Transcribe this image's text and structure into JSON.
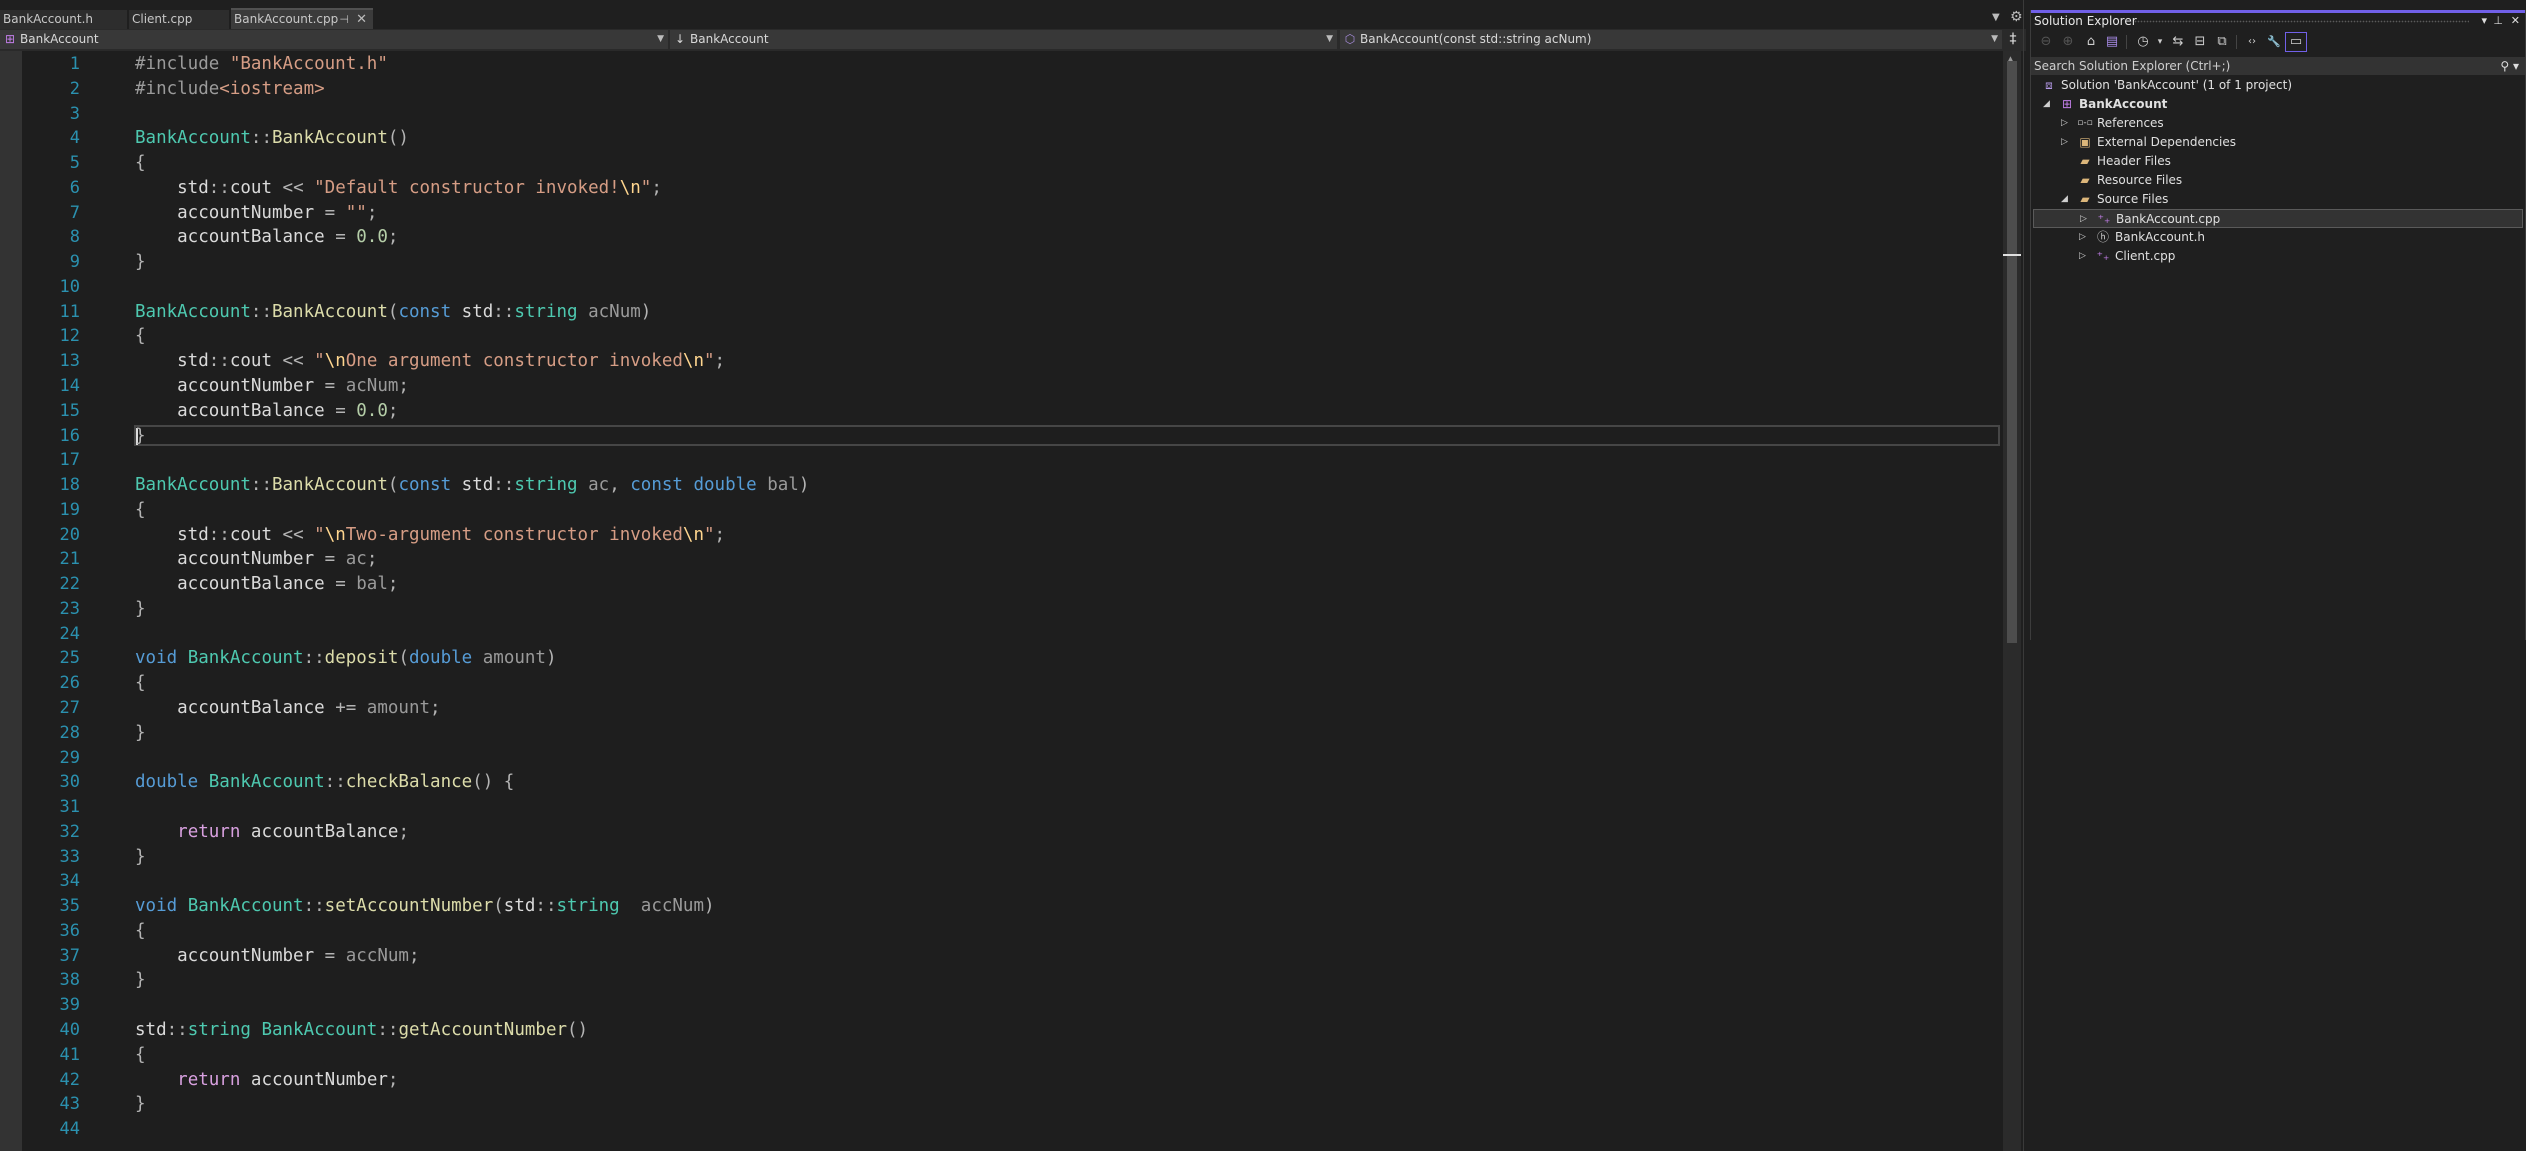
{
  "tabs": [
    {
      "label": "BankAccount.h",
      "active": false
    },
    {
      "label": "Client.cpp",
      "active": false
    },
    {
      "label": "BankAccount.cpp",
      "active": true
    }
  ],
  "tab_icons": {
    "pin": "⊣",
    "close": "✕",
    "overflow": "▼",
    "settings": "⚙"
  },
  "navbar": {
    "project": "BankAccount",
    "scope": "BankAccount",
    "member": "BankAccount(const std::string acNum)"
  },
  "editor": {
    "current_line": 16,
    "line_count": 44,
    "lines": [
      [
        [
          "pp",
          "#include "
        ],
        [
          "st",
          "\"BankAccount.h\""
        ]
      ],
      [
        [
          "pp",
          "#include"
        ],
        [
          "st",
          "<iostream>"
        ]
      ],
      [],
      [
        [
          "ty",
          "BankAccount"
        ],
        [
          "op",
          "::"
        ],
        [
          "fn",
          "BankAccount"
        ],
        [
          "op",
          "()"
        ]
      ],
      [
        [
          "op",
          "{"
        ]
      ],
      [
        [
          "mem",
          "    std"
        ],
        [
          "op",
          "::"
        ],
        [
          "mem",
          "cout "
        ],
        [
          "op",
          "<< "
        ],
        [
          "st",
          "\"Default constructor invoked!"
        ],
        [
          "es",
          "\\n"
        ],
        [
          "st",
          "\""
        ],
        [
          "op",
          ";"
        ]
      ],
      [
        [
          "mem",
          "    accountNumber "
        ],
        [
          "op",
          "= "
        ],
        [
          "st",
          "\"\""
        ],
        [
          "op",
          ";"
        ]
      ],
      [
        [
          "mem",
          "    accountBalance "
        ],
        [
          "op",
          "= "
        ],
        [
          "nu",
          "0.0"
        ],
        [
          "op",
          ";"
        ]
      ],
      [
        [
          "op",
          "}"
        ]
      ],
      [],
      [
        [
          "ty",
          "BankAccount"
        ],
        [
          "op",
          "::"
        ],
        [
          "fn",
          "BankAccount"
        ],
        [
          "op",
          "("
        ],
        [
          "kw",
          "const "
        ],
        [
          "mem",
          "std"
        ],
        [
          "op",
          "::"
        ],
        [
          "ty",
          "string "
        ],
        [
          "pa",
          "acNum"
        ],
        [
          "op",
          ")"
        ]
      ],
      [
        [
          "op",
          "{"
        ]
      ],
      [
        [
          "mem",
          "    std"
        ],
        [
          "op",
          "::"
        ],
        [
          "mem",
          "cout "
        ],
        [
          "op",
          "<< "
        ],
        [
          "st",
          "\""
        ],
        [
          "es",
          "\\n"
        ],
        [
          "st",
          "One argument constructor invoked"
        ],
        [
          "es",
          "\\n"
        ],
        [
          "st",
          "\""
        ],
        [
          "op",
          ";"
        ]
      ],
      [
        [
          "mem",
          "    accountNumber "
        ],
        [
          "op",
          "= "
        ],
        [
          "pa",
          "acNum"
        ],
        [
          "op",
          ";"
        ]
      ],
      [
        [
          "mem",
          "    accountBalance "
        ],
        [
          "op",
          "= "
        ],
        [
          "nu",
          "0.0"
        ],
        [
          "op",
          ";"
        ]
      ],
      [
        [
          "op",
          "}"
        ]
      ],
      [],
      [
        [
          "ty",
          "BankAccount"
        ],
        [
          "op",
          "::"
        ],
        [
          "fn",
          "BankAccount"
        ],
        [
          "op",
          "("
        ],
        [
          "kw",
          "const "
        ],
        [
          "mem",
          "std"
        ],
        [
          "op",
          "::"
        ],
        [
          "ty",
          "string "
        ],
        [
          "pa",
          "ac"
        ],
        [
          "op",
          ", "
        ],
        [
          "kw",
          "const double "
        ],
        [
          "pa",
          "bal"
        ],
        [
          "op",
          ")"
        ]
      ],
      [
        [
          "op",
          "{"
        ]
      ],
      [
        [
          "mem",
          "    std"
        ],
        [
          "op",
          "::"
        ],
        [
          "mem",
          "cout "
        ],
        [
          "op",
          "<< "
        ],
        [
          "st",
          "\""
        ],
        [
          "es",
          "\\n"
        ],
        [
          "st",
          "Two-argument constructor invoked"
        ],
        [
          "es",
          "\\n"
        ],
        [
          "st",
          "\""
        ],
        [
          "op",
          ";"
        ]
      ],
      [
        [
          "mem",
          "    accountNumber "
        ],
        [
          "op",
          "= "
        ],
        [
          "pa",
          "ac"
        ],
        [
          "op",
          ";"
        ]
      ],
      [
        [
          "mem",
          "    accountBalance "
        ],
        [
          "op",
          "= "
        ],
        [
          "pa",
          "bal"
        ],
        [
          "op",
          ";"
        ]
      ],
      [
        [
          "op",
          "}"
        ]
      ],
      [],
      [
        [
          "kw",
          "void "
        ],
        [
          "ty",
          "BankAccount"
        ],
        [
          "op",
          "::"
        ],
        [
          "fn",
          "deposit"
        ],
        [
          "op",
          "("
        ],
        [
          "kw",
          "double "
        ],
        [
          "pa",
          "amount"
        ],
        [
          "op",
          ")"
        ]
      ],
      [
        [
          "op",
          "{"
        ]
      ],
      [
        [
          "mem",
          "    accountBalance "
        ],
        [
          "op",
          "+= "
        ],
        [
          "pa",
          "amount"
        ],
        [
          "op",
          ";"
        ]
      ],
      [
        [
          "op",
          "}"
        ]
      ],
      [],
      [
        [
          "kw",
          "double "
        ],
        [
          "ty",
          "BankAccount"
        ],
        [
          "op",
          "::"
        ],
        [
          "fn",
          "checkBalance"
        ],
        [
          "op",
          "() {"
        ]
      ],
      [],
      [
        [
          "mem",
          "    "
        ],
        [
          "ret",
          "return "
        ],
        [
          "mem",
          "accountBalance"
        ],
        [
          "op",
          ";"
        ]
      ],
      [
        [
          "op",
          "}"
        ]
      ],
      [],
      [
        [
          "kw",
          "void "
        ],
        [
          "ty",
          "BankAccount"
        ],
        [
          "op",
          "::"
        ],
        [
          "fn",
          "setAccountNumber"
        ],
        [
          "op",
          "("
        ],
        [
          "mem",
          "std"
        ],
        [
          "op",
          "::"
        ],
        [
          "ty",
          "string  "
        ],
        [
          "pa",
          "accNum"
        ],
        [
          "op",
          ")"
        ]
      ],
      [
        [
          "op",
          "{"
        ]
      ],
      [
        [
          "mem",
          "    accountNumber "
        ],
        [
          "op",
          "= "
        ],
        [
          "pa",
          "accNum"
        ],
        [
          "op",
          ";"
        ]
      ],
      [
        [
          "op",
          "}"
        ]
      ],
      [],
      [
        [
          "mem",
          "std"
        ],
        [
          "op",
          "::"
        ],
        [
          "ty",
          "string "
        ],
        [
          "ty",
          "BankAccount"
        ],
        [
          "op",
          "::"
        ],
        [
          "fn",
          "getAccountNumber"
        ],
        [
          "op",
          "()"
        ]
      ],
      [
        [
          "op",
          "{"
        ]
      ],
      [
        [
          "mem",
          "    "
        ],
        [
          "ret",
          "return "
        ],
        [
          "mem",
          "accountNumber"
        ],
        [
          "op",
          ";"
        ]
      ],
      [
        [
          "op",
          "}"
        ]
      ],
      []
    ]
  },
  "scrollbar": {
    "position_fraction": 0.0,
    "visible_fraction": 1.0
  },
  "solution_explorer": {
    "title": "Solution Explorer",
    "title_controls": {
      "dropdown": "▾",
      "pin": "⊥",
      "close": "✕"
    },
    "toolbar": [
      {
        "name": "back-button",
        "glyph": "⊖",
        "disabled": true
      },
      {
        "name": "forward-button",
        "glyph": "⊕",
        "disabled": true
      },
      {
        "name": "home-button",
        "glyph": "⌂",
        "disabled": false
      },
      {
        "name": "switch-views-button",
        "glyph": "▤",
        "disabled": false
      },
      {
        "name": "pending-changes-filter-button",
        "glyph": "◷",
        "disabled": false
      },
      {
        "name": "pending-changes-dropdown",
        "glyph": "▾",
        "disabled": false
      },
      {
        "name": "sync-with-active-document-button",
        "glyph": "⇆",
        "disabled": false
      },
      {
        "name": "collapse-all-button",
        "glyph": "⊟",
        "disabled": false
      },
      {
        "name": "show-all-files-button",
        "glyph": "⧉",
        "disabled": false
      },
      {
        "name": "view-code-button",
        "glyph": "‹›",
        "disabled": false
      },
      {
        "name": "properties-button",
        "glyph": "🔧",
        "disabled": false
      },
      {
        "name": "preview-selected-items-button",
        "glyph": "▭",
        "disabled": false,
        "selected": true
      }
    ],
    "search_placeholder": "Search Solution Explorer (Ctrl+;)",
    "tree": [
      {
        "label": "Solution 'BankAccount' (1 of 1 project)",
        "level": 0,
        "icon": "solution",
        "expander": "",
        "bold": false
      },
      {
        "label": "BankAccount",
        "level": 1,
        "icon": "project",
        "expander": "◢",
        "bold": true
      },
      {
        "label": "References",
        "level": 2,
        "icon": "references",
        "expander": "▷",
        "bold": false
      },
      {
        "label": "External Dependencies",
        "level": 2,
        "icon": "folder-external",
        "expander": "▷",
        "bold": false
      },
      {
        "label": "Header Files",
        "level": 2,
        "icon": "filter-folder",
        "expander": "",
        "bold": false
      },
      {
        "label": "Resource Files",
        "level": 2,
        "icon": "filter-folder",
        "expander": "",
        "bold": false
      },
      {
        "label": "Source Files",
        "level": 2,
        "icon": "filter-folder",
        "expander": "◢",
        "bold": false
      },
      {
        "label": "BankAccount.cpp",
        "level": 3,
        "icon": "cpp-file",
        "expander": "▷",
        "bold": false,
        "selected": true
      },
      {
        "label": "BankAccount.h",
        "level": 3,
        "icon": "header-file",
        "expander": "▷",
        "bold": false
      },
      {
        "label": "Client.cpp",
        "level": 3,
        "icon": "cpp-file",
        "expander": "▷",
        "bold": false
      }
    ]
  },
  "colors": {
    "accent": "#7160e8",
    "line_number": "#2b91af",
    "keyword": "#569cd6",
    "type": "#4ec9b0",
    "function": "#dcdcaa",
    "string": "#d69d85",
    "escape": "#ffd68f",
    "number": "#b5cea8",
    "control_keyword": "#d8a0df"
  }
}
